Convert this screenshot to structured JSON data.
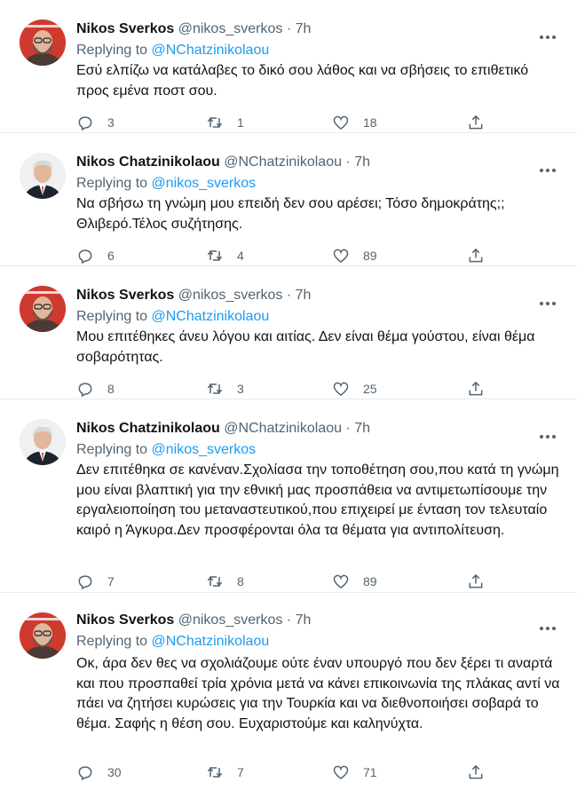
{
  "tweets": [
    {
      "name": "Nikos Sverkos",
      "handle": "@nikos_sverkos",
      "time": "7h",
      "replying_label": "Replying to",
      "replying_to": "@NChatzinikolaou",
      "text": "Εσύ ελπίζω να κατάλαβες το δικό σου λάθος και να σβήσεις το επιθετικό προς εμένα ποστ σου.",
      "replies": "3",
      "retweets": "1",
      "likes": "18",
      "avatar": "sverkos"
    },
    {
      "name": "Nikos Chatzinikolaou",
      "handle": "@NChatzinikolaou",
      "time": "7h",
      "replying_label": "Replying to",
      "replying_to": "@nikos_sverkos",
      "text": "Να σβήσω τη γνώμη μου επειδή δεν σου αρέσει; Τόσο δημοκράτης;; Θλιβερό.Τέλος συζήτησης.",
      "replies": "6",
      "retweets": "4",
      "likes": "89",
      "avatar": "chatz"
    },
    {
      "name": "Nikos Sverkos",
      "handle": "@nikos_sverkos",
      "time": "7h",
      "replying_label": "Replying to",
      "replying_to": "@NChatzinikolaou",
      "text": "Μου επιτέθηκες άνευ λόγου και αιτίας. Δεν είναι θέμα γούστου, είναι θέμα σοβαρότητας.",
      "replies": "8",
      "retweets": "3",
      "likes": "25",
      "avatar": "sverkos"
    },
    {
      "name": "Nikos Chatzinikolaou",
      "handle": "@NChatzinikolaou",
      "time": "7h",
      "replying_label": "Replying to",
      "replying_to": "@nikos_sverkos",
      "text": "Δεν επιτέθηκα σε κανέναν.Σχολίασα την τοποθέτηση σου,που κατά τη γνώμη μου είναι βλαπτική για την εθνική μας προσπάθεια να αντιμετωπίσουμε την εργαλειοποίηση του μεταναστευτικού,που επιχειρεί με ένταση τον τελευταίο καιρό η Άγκυρα.Δεν προσφέρονται όλα τα θέματα για αντιπολίτευση.",
      "replies": "7",
      "retweets": "8",
      "likes": "89",
      "avatar": "chatz"
    },
    {
      "name": "Nikos Sverkos",
      "handle": "@nikos_sverkos",
      "time": "7h",
      "replying_label": "Replying to",
      "replying_to": "@NChatzinikolaou",
      "text": "Οκ, άρα δεν θες να σχολιάζουμε ούτε έναν υπουργό που δεν ξέρει τι αναρτά και που προσπαθεί τρία χρόνια μετά να κάνει επικοινωνία της πλάκας αντί να πάει να ζητήσει κυρώσεις για την Τουρκία και να διεθνοποιήσει σοβαρά το θέμα. Σαφής η θέση σου. Ευχαριστούμε και καληνύχτα.",
      "replies": "30",
      "retweets": "7",
      "likes": "71",
      "avatar": "sverkos"
    }
  ],
  "separator": "·",
  "colors": {
    "link": "#1d9bf0",
    "muted": "#536471",
    "text": "#0f1419"
  },
  "icons": [
    "reply-icon",
    "retweet-icon",
    "like-icon",
    "share-icon",
    "more-icon"
  ]
}
